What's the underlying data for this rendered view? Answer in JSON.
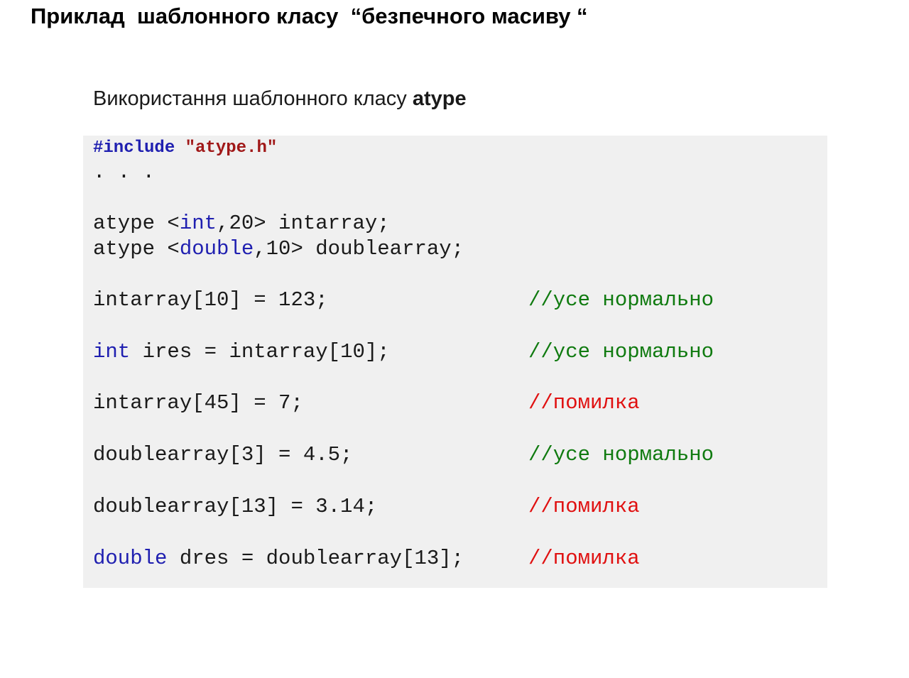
{
  "slide": {
    "title": "Приклад  шаблонного класу  “безпечного масиву “",
    "subtitle_prefix": "Використання шаблонного класу ",
    "subtitle_class": "atype"
  },
  "code": {
    "line1_directive": "#include",
    "line1_file": "\"atype.h\"",
    "line2": ". . .",
    "line3_type": "atype <",
    "line3_kw": "int",
    "line3_rest": ",20> intarray;",
    "line4_type": "atype <",
    "line4_kw": "double",
    "line4_rest": ",10> doublearray;",
    "line5": "intarray[10] = 123;",
    "line5_comment": "//усе нормально",
    "line6_kw": "int",
    "line6_rest": " ires = intarray[10];",
    "line6_comment": "//усе нормально",
    "line7": "intarray[45] = 7;",
    "line7_comment": "//помилка",
    "line8": "doublearray[3] = 4.5;",
    "line8_comment": "//усе нормально",
    "line9": "doublearray[13] = 3.14;",
    "line9_comment": "//помилка",
    "line10_kw": "double",
    "line10_rest": " dres = doublearray[13];",
    "line10_comment": "//помилка"
  },
  "colors": {
    "keyword": "#1f1fb0",
    "string": "#a01818",
    "comment_ok": "#0f7a0f",
    "comment_error": "#e01010",
    "code_background": "#f0f0f0"
  }
}
